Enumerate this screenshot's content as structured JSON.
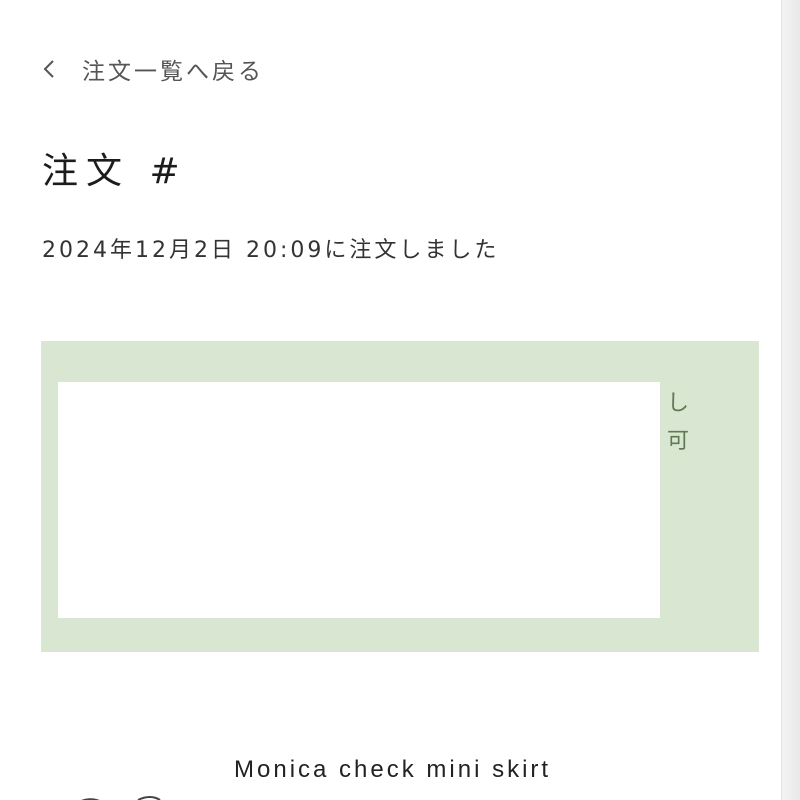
{
  "nav": {
    "back_label": "注文一覧へ戻る",
    "back_icon": "chevron-left-icon"
  },
  "order": {
    "title": "注文 #",
    "placed_text": "2024年12月2日 20:09に注文しました"
  },
  "status_panel": {
    "side_text": [
      "し",
      "可"
    ],
    "colors": {
      "panel_bg": "#d9e6d2",
      "side_text": "#5f7a52"
    }
  },
  "items": [
    {
      "name": "Monica check mini skirt"
    }
  ]
}
